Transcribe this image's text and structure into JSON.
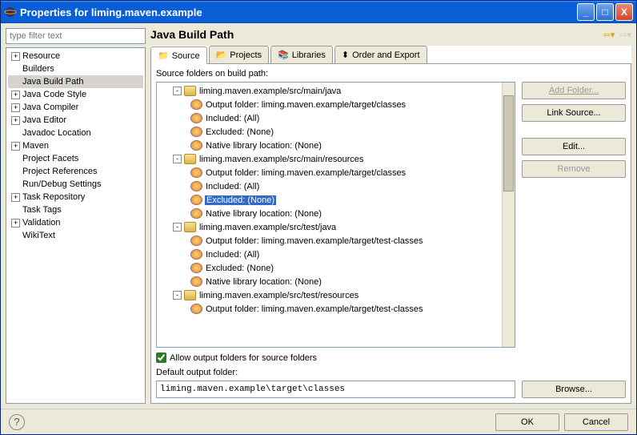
{
  "window": {
    "title": "Properties for liming.maven.example"
  },
  "filter_placeholder": "type filter text",
  "left_tree": [
    {
      "label": "Resource",
      "twist": "+"
    },
    {
      "label": "Builders"
    },
    {
      "label": "Java Build Path",
      "selected": true
    },
    {
      "label": "Java Code Style",
      "twist": "+"
    },
    {
      "label": "Java Compiler",
      "twist": "+"
    },
    {
      "label": "Java Editor",
      "twist": "+"
    },
    {
      "label": "Javadoc Location"
    },
    {
      "label": "Maven",
      "twist": "+"
    },
    {
      "label": "Project Facets"
    },
    {
      "label": "Project References"
    },
    {
      "label": "Run/Debug Settings"
    },
    {
      "label": "Task Repository",
      "twist": "+"
    },
    {
      "label": "Task Tags"
    },
    {
      "label": "Validation",
      "twist": "+"
    },
    {
      "label": "WikiText"
    }
  ],
  "page_title": "Java Build Path",
  "tabs": [
    "Source",
    "Projects",
    "Libraries",
    "Order and Export"
  ],
  "src_label": "Source folders on build path:",
  "src_folders": [
    {
      "path": "liming.maven.example/src/main/java",
      "output": "Output folder: liming.maven.example/target/classes",
      "included": "Included: (All)",
      "excluded": "Excluded: (None)",
      "native": "Native library location: (None)"
    },
    {
      "path": "liming.maven.example/src/main/resources",
      "output": "Output folder: liming.maven.example/target/classes",
      "included": "Included: (All)",
      "excluded": "Excluded: (None)",
      "excluded_sel": true,
      "native": "Native library location: (None)"
    },
    {
      "path": "liming.maven.example/src/test/java",
      "output": "Output folder: liming.maven.example/target/test-classes",
      "included": "Included: (All)",
      "excluded": "Excluded: (None)",
      "native": "Native library location: (None)"
    },
    {
      "path": "liming.maven.example/src/test/resources",
      "output": "Output folder: liming.maven.example/target/test-classes"
    }
  ],
  "buttons": {
    "add_folder": "Add Folder...",
    "link_source": "Link Source...",
    "edit": "Edit...",
    "remove": "Remove",
    "browse": "Browse...",
    "ok": "OK",
    "cancel": "Cancel"
  },
  "allow_label": "Allow output folders for source folders",
  "default_label": "Default output folder:",
  "default_value": "liming.maven.example\\target\\classes"
}
